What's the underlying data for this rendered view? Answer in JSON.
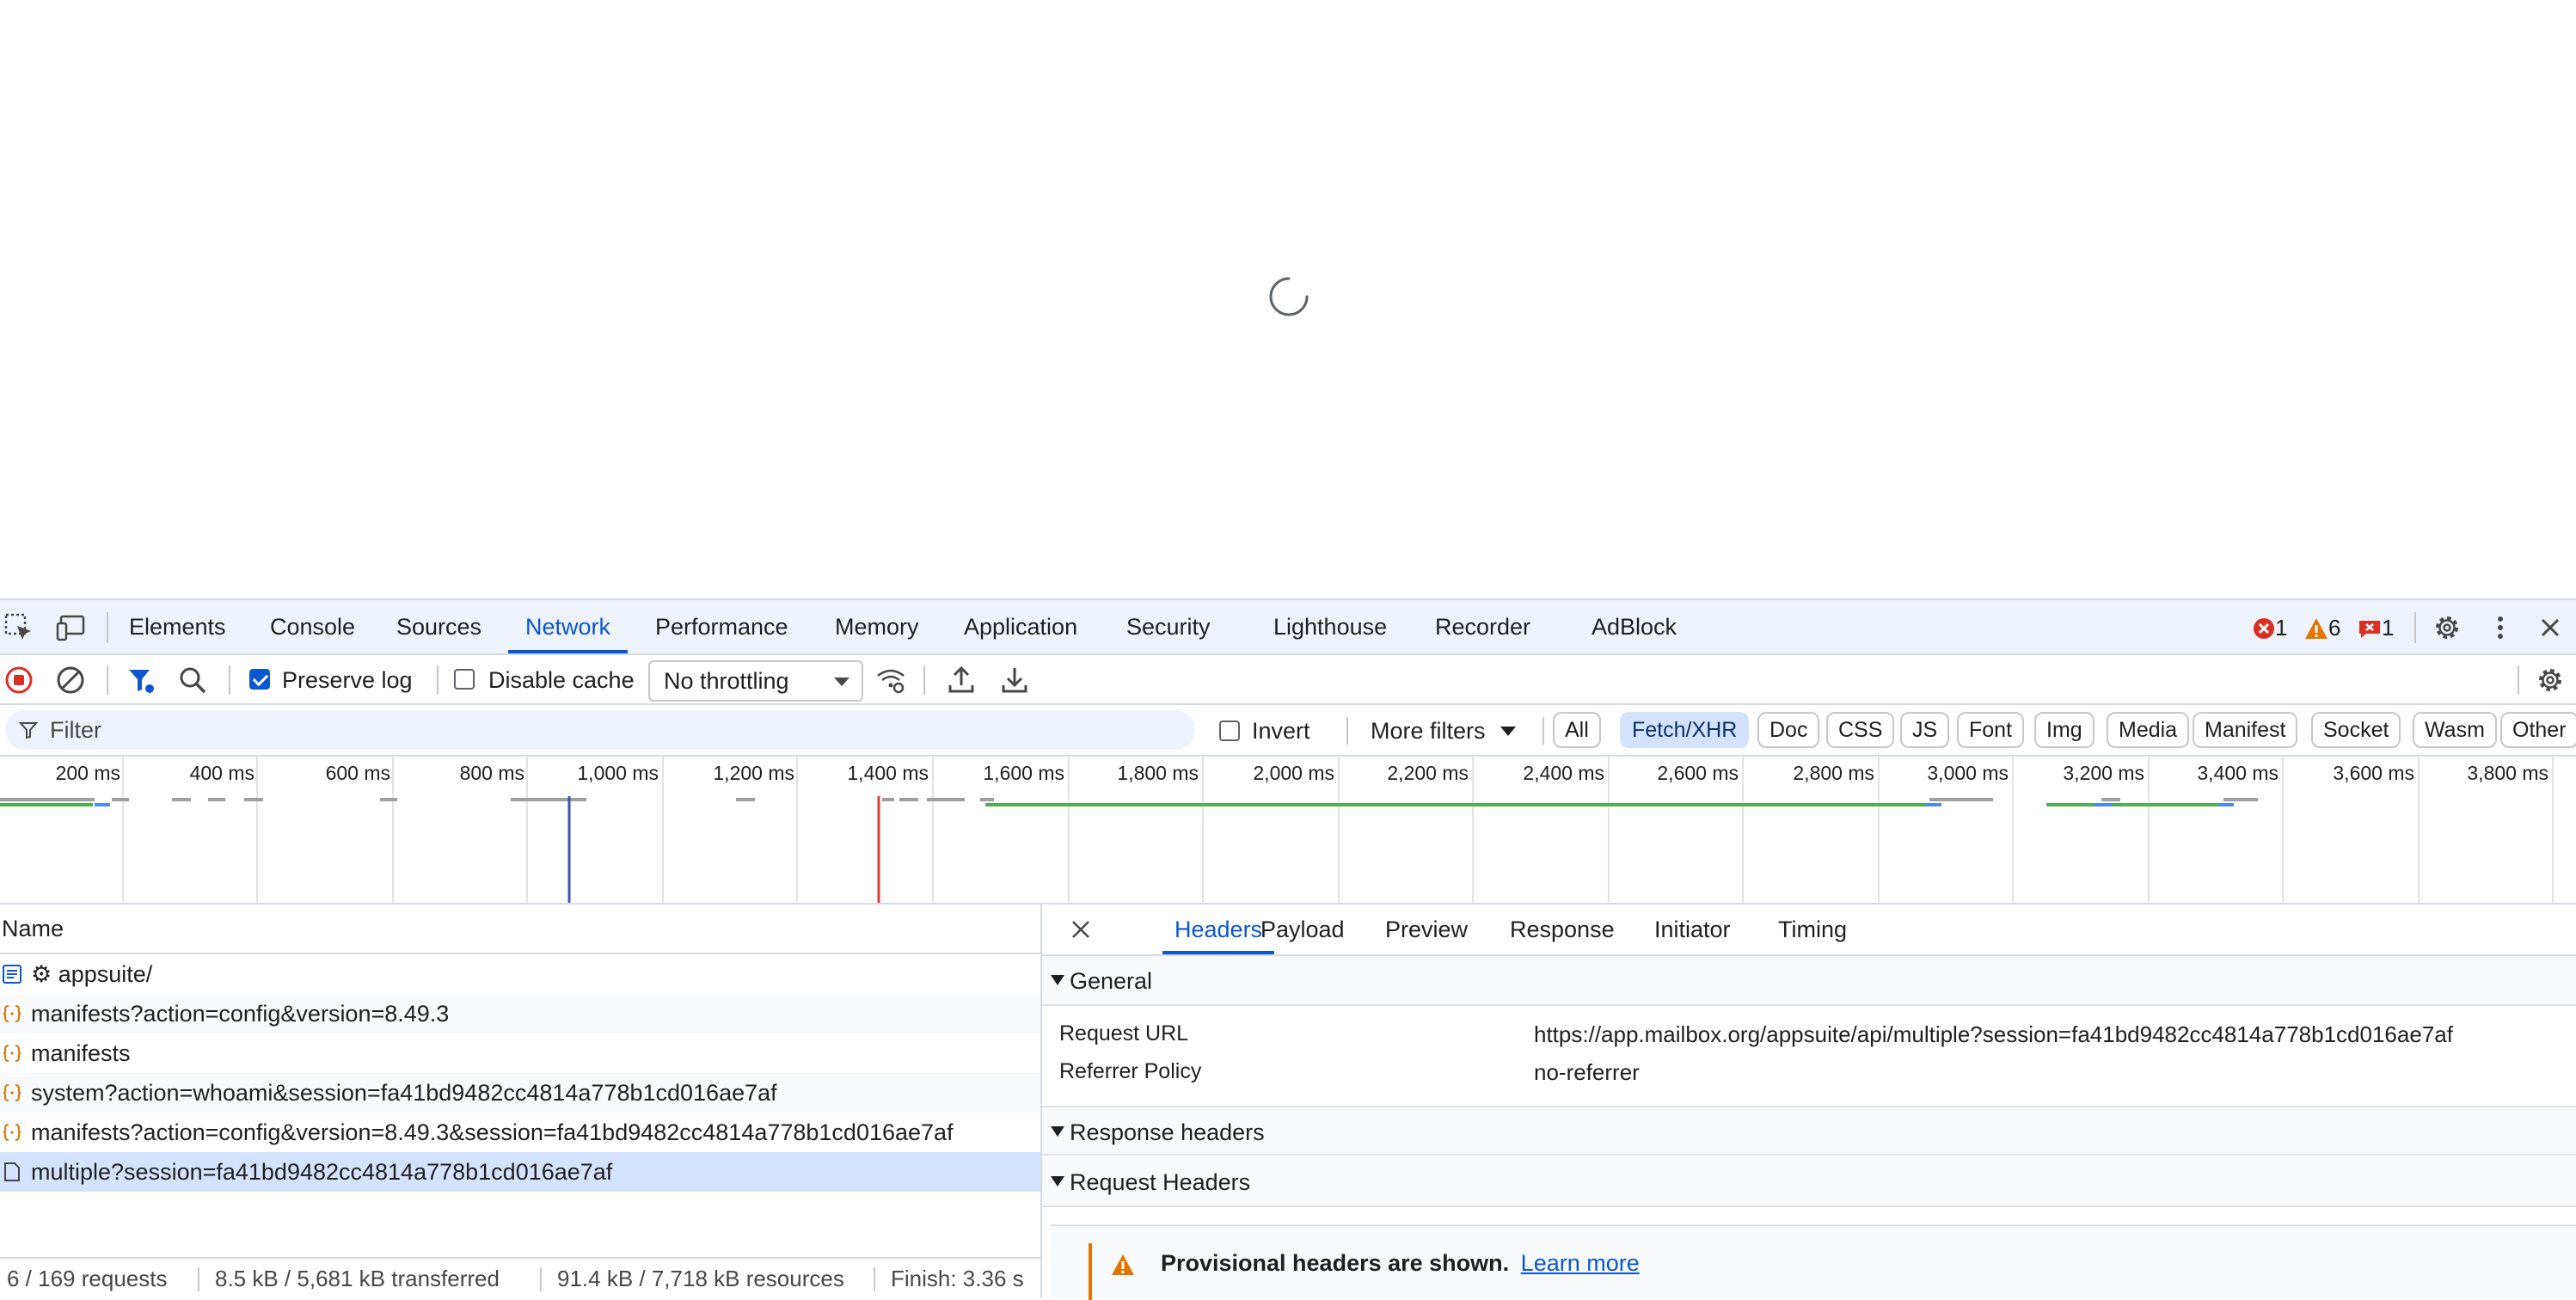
{
  "devtools": {
    "tabs": [
      "Elements",
      "Console",
      "Sources",
      "Network",
      "Performance",
      "Memory",
      "Application",
      "Security",
      "Lighthouse",
      "Recorder",
      "AdBlock"
    ],
    "active_tab": "Network",
    "counters": {
      "errors": "1",
      "warnings": "6",
      "issues": "1"
    }
  },
  "toolbar": {
    "preserve_log_label": "Preserve log",
    "preserve_log_checked": true,
    "disable_cache_label": "Disable cache",
    "disable_cache_checked": false,
    "throttling_value": "No throttling"
  },
  "filterbar": {
    "placeholder": "Filter",
    "invert_label": "Invert",
    "more_filters_label": "More filters",
    "chips": [
      "All",
      "Fetch/XHR",
      "Doc",
      "CSS",
      "JS",
      "Font",
      "Img",
      "Media",
      "Manifest",
      "Socket",
      "Wasm",
      "Other"
    ],
    "active_chip": "Fetch/XHR"
  },
  "overview": {
    "ticks": [
      "200 ms",
      "400 ms",
      "600 ms",
      "800 ms",
      "1,000 ms",
      "1,200 ms",
      "1,400 ms",
      "1,600 ms",
      "1,800 ms",
      "2,000 ms",
      "2,200 ms",
      "2,400 ms",
      "2,600 ms",
      "2,800 ms",
      "3,000 ms",
      "3,200 ms",
      "3,400 ms",
      "3,600 ms",
      "3,800 ms"
    ]
  },
  "requests": {
    "column_name": "Name",
    "rows": [
      {
        "name": "⚙ appsuite/",
        "icon": "document-icon"
      },
      {
        "name": "manifests?action=config&version=8.49.3",
        "icon": "json-icon"
      },
      {
        "name": "manifests",
        "icon": "json-icon"
      },
      {
        "name": "system?action=whoami&session=fa41bd9482cc4814a778b1cd016ae7af",
        "icon": "json-icon"
      },
      {
        "name": "manifests?action=config&version=8.49.3&session=fa41bd9482cc4814a778b1cd016ae7af",
        "icon": "json-icon"
      },
      {
        "name": "multiple?session=fa41bd9482cc4814a778b1cd016ae7af",
        "icon": "file-icon"
      }
    ],
    "selected_index": 5
  },
  "statusbar": {
    "requests": "6 / 169 requests",
    "transferred": "8.5 kB / 5,681 kB transferred",
    "resources": "91.4 kB / 7,718 kB resources",
    "finish": "Finish: 3.36 s"
  },
  "details": {
    "tabs": [
      "Headers",
      "Payload",
      "Preview",
      "Response",
      "Initiator",
      "Timing"
    ],
    "active_tab": "Headers",
    "general_label": "General",
    "request_url_key": "Request URL",
    "request_url_value": "https://app.mailbox.org/appsuite/api/multiple?session=fa41bd9482cc4814a778b1cd016ae7af",
    "referrer_policy_key": "Referrer Policy",
    "referrer_policy_value": "no-referrer",
    "response_headers_label": "Response headers",
    "request_headers_label": "Request Headers",
    "provisional_text": "Provisional headers are shown.",
    "learn_more": "Learn more"
  },
  "colors": {
    "accent": "#0b57d0",
    "active_chip_bg": "#d3e3fd",
    "error": "#d93025",
    "warning": "#e37400"
  }
}
